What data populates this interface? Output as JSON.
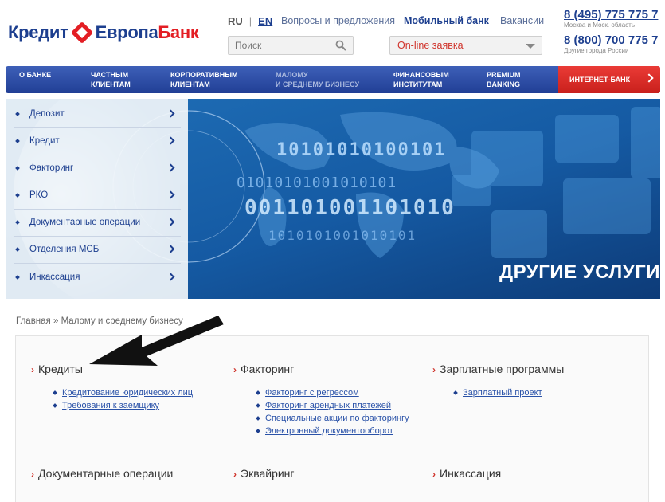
{
  "logo": {
    "part1": "Кредит",
    "part2": "Европа",
    "part3": "Банк"
  },
  "lang": {
    "ru": "RU",
    "sep": "|",
    "en": "EN"
  },
  "toplinks": {
    "feedback": "Вопросы и предложения",
    "mobile": "Мобильный банк",
    "jobs": "Вакансии"
  },
  "search": {
    "placeholder": "Поиск"
  },
  "apply": {
    "label": "On-line заявка"
  },
  "phones": [
    {
      "number": "8 (495) 775 775 7",
      "note": "Москва и Моск. область"
    },
    {
      "number": "8 (800) 700 775 7",
      "note": "Другие города России"
    }
  ],
  "nav": {
    "items": [
      {
        "l1": "О банке",
        "l2": ""
      },
      {
        "l1": "Частным",
        "l2": "клиентам"
      },
      {
        "l1": "Корпоративным",
        "l2": "клиентам"
      },
      {
        "l1": "Малому",
        "l2": "и среднему бизнесу"
      },
      {
        "l1": "Финансовым",
        "l2": "институтам"
      },
      {
        "l1": "Premium",
        "l2": "Banking"
      }
    ],
    "internet_bank": "ИНТЕРНЕТ-БАНК"
  },
  "sidemenu": [
    "Депозит",
    "Кредит",
    "Факторинг",
    "РКО",
    "Документарные операции",
    "Отделения МСБ",
    "Инкассация"
  ],
  "hero": {
    "title": "ДРУГИЕ УСЛУГИ",
    "binary": [
      "10101010100101",
      "01010101001010101",
      "001101001101010",
      "1010101001010101"
    ]
  },
  "breadcrumb": {
    "home": "Главная",
    "sep": "»",
    "current": "Малому и среднему бизнесу"
  },
  "services": {
    "categories": [
      {
        "title": "Кредиты",
        "links": [
          "Кредитование юридических лиц",
          "Требования к заемщику"
        ]
      },
      {
        "title": "Факторинг",
        "links": [
          "Факторинг с регрессом",
          "Факторинг арендных платежей",
          "Специальные акции по факторингу",
          "Электронный документооборот"
        ]
      },
      {
        "title": "Зарплатные программы",
        "links": [
          "Зарплатный проект"
        ]
      },
      {
        "title": "Документарные операции",
        "links": []
      },
      {
        "title": "Эквайринг",
        "links": []
      },
      {
        "title": "Инкассация",
        "links": []
      }
    ],
    "marker": "›"
  },
  "colors": {
    "brand_blue": "#1d3f8f",
    "brand_red": "#e31e24",
    "link_blue": "#2a52a8"
  }
}
